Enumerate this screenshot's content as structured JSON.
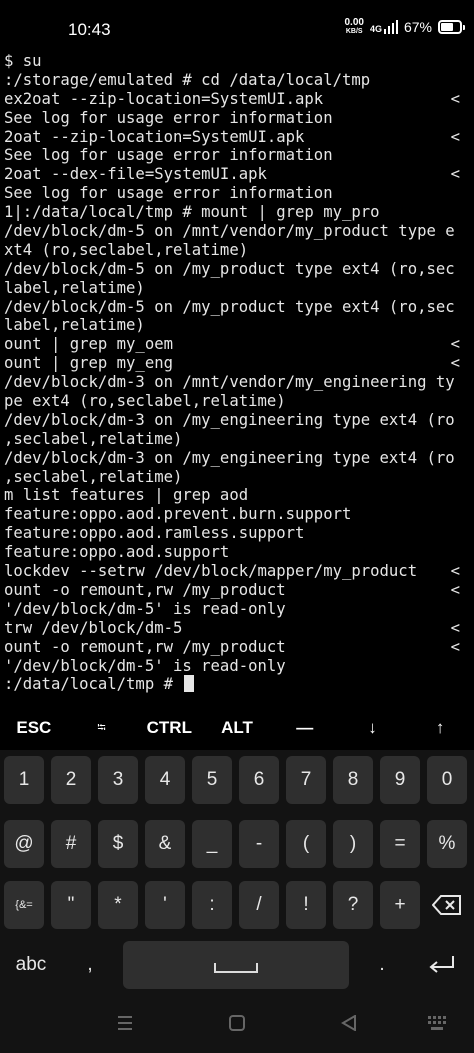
{
  "status": {
    "time": "10:43",
    "net_speed": "0.00",
    "net_unit": "KB/S",
    "signal_label": "4G",
    "battery": "67%"
  },
  "terminal": {
    "lines": [
      {
        "text": "$ su",
        "trunc": ""
      },
      {
        "text": ":/storage/emulated # cd /data/local/tmp",
        "trunc": ""
      },
      {
        "text": "ex2oat --zip-location=SystemUI.apk",
        "trunc": "<"
      },
      {
        "text": "See log for usage error information",
        "trunc": ""
      },
      {
        "text": "2oat --zip-location=SystemUI.apk",
        "trunc": "<"
      },
      {
        "text": "See log for usage error information",
        "trunc": ""
      },
      {
        "text": "2oat --dex-file=SystemUI.apk",
        "trunc": "<"
      },
      {
        "text": "See log for usage error information",
        "trunc": ""
      },
      {
        "text": "1|:/data/local/tmp # mount | grep my_pro",
        "trunc": ""
      },
      {
        "text": "/dev/block/dm-5 on /mnt/vendor/my_product type e",
        "trunc": ""
      },
      {
        "text": "xt4 (ro,seclabel,relatime)",
        "trunc": ""
      },
      {
        "text": "/dev/block/dm-5 on /my_product type ext4 (ro,sec",
        "trunc": ""
      },
      {
        "text": "label,relatime)",
        "trunc": ""
      },
      {
        "text": "/dev/block/dm-5 on /my_product type ext4 (ro,sec",
        "trunc": ""
      },
      {
        "text": "label,relatime)",
        "trunc": ""
      },
      {
        "text": "ount | grep my_oem",
        "trunc": "<"
      },
      {
        "text": "ount | grep my_eng",
        "trunc": "<"
      },
      {
        "text": "/dev/block/dm-3 on /mnt/vendor/my_engineering ty",
        "trunc": ""
      },
      {
        "text": "pe ext4 (ro,seclabel,relatime)",
        "trunc": ""
      },
      {
        "text": "/dev/block/dm-3 on /my_engineering type ext4 (ro",
        "trunc": ""
      },
      {
        "text": ",seclabel,relatime)",
        "trunc": ""
      },
      {
        "text": "/dev/block/dm-3 on /my_engineering type ext4 (ro",
        "trunc": ""
      },
      {
        "text": ",seclabel,relatime)",
        "trunc": ""
      },
      {
        "text": "m list features | grep aod",
        "trunc": ""
      },
      {
        "text": "feature:oppo.aod.prevent.burn.support",
        "trunc": ""
      },
      {
        "text": "feature:oppo.aod.ramless.support",
        "trunc": ""
      },
      {
        "text": "feature:oppo.aod.support",
        "trunc": ""
      },
      {
        "text": "lockdev --setrw /dev/block/mapper/my_product",
        "trunc": "<"
      },
      {
        "text": "ount -o remount,rw /my_product",
        "trunc": "<"
      },
      {
        "text": "'/dev/block/dm-5' is read-only",
        "trunc": ""
      },
      {
        "text": "trw /dev/block/dm-5",
        "trunc": "<"
      },
      {
        "text": "ount -o remount,rw /my_product",
        "trunc": "<"
      },
      {
        "text": "'/dev/block/dm-5' is read-only",
        "trunc": ""
      }
    ],
    "prompt": ":/data/local/tmp # "
  },
  "extra_keys": [
    "ESC",
    "⭾",
    "CTRL",
    "ALT",
    "—",
    "↓",
    "↑"
  ],
  "keyboard": {
    "row1": [
      "1",
      "2",
      "3",
      "4",
      "5",
      "6",
      "7",
      "8",
      "9",
      "0"
    ],
    "row2": [
      "@",
      "#",
      "$",
      "&",
      "_",
      "-",
      "(",
      ")",
      "=",
      "%"
    ],
    "row3": [
      "{&=",
      "\"",
      "*",
      "'",
      ":",
      "/",
      "!",
      "?",
      "+"
    ],
    "abc": "abc",
    "comma": ",",
    "period": "."
  }
}
